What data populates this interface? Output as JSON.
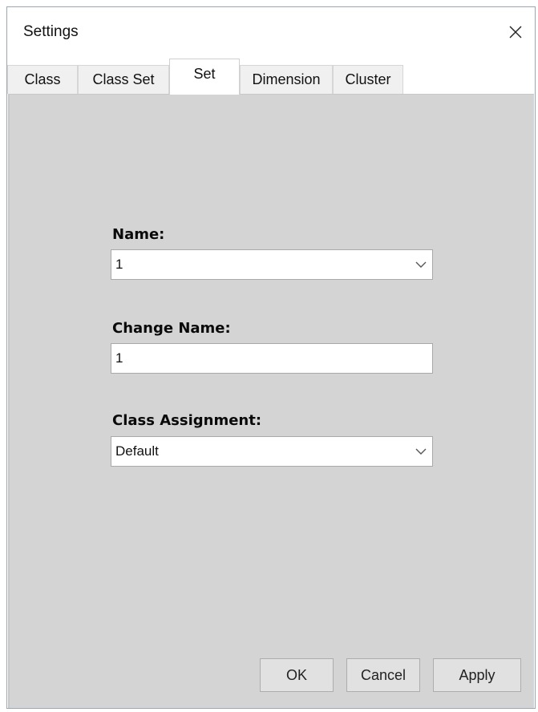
{
  "window": {
    "title": "Settings"
  },
  "tabs": [
    {
      "label": "Class",
      "active": false
    },
    {
      "label": "Class Set",
      "active": false
    },
    {
      "label": "Set",
      "active": true
    },
    {
      "label": "Dimension",
      "active": false
    },
    {
      "label": "Cluster",
      "active": false
    }
  ],
  "form": {
    "name_label": "Name:",
    "name_value": "1",
    "change_name_label": "Change Name:",
    "change_name_value": "1",
    "class_assignment_label": "Class Assignment:",
    "class_assignment_value": "Default"
  },
  "buttons": {
    "ok": "OK",
    "cancel": "Cancel",
    "apply": "Apply"
  },
  "colors": {
    "panel_background": "#d4d4d4",
    "button_face": "#e1e1e1"
  }
}
